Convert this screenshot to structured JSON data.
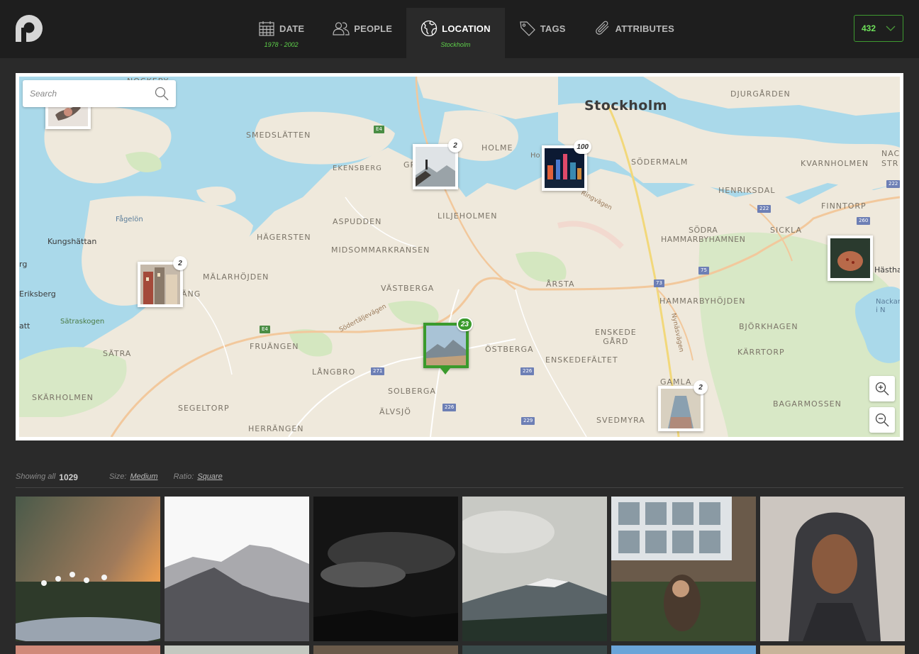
{
  "header": {
    "tabs": [
      {
        "label": "DATE",
        "sub": "1978 - 2002"
      },
      {
        "label": "PEOPLE",
        "sub": ""
      },
      {
        "label": "LOCATION",
        "sub": "Stockholm"
      },
      {
        "label": "TAGS",
        "sub": ""
      },
      {
        "label": "ATTRIBUTES",
        "sub": ""
      }
    ],
    "active_tab": "LOCATION",
    "count": "432"
  },
  "map": {
    "search_placeholder": "Search",
    "labels": {
      "stockholm": "Stockholm",
      "djurgarden": "DJURGÅRDEN",
      "nockeby": "NOCKEBY",
      "smedslatten": "SMEDSLÄTTEN",
      "ekensberg": "EKENSBERG",
      "holme": "HOLME",
      "sodermalm": "SÖDERMALM",
      "kvarnholmen": "KVARNHOLMEN",
      "nac": "NAC",
      "str": "STR",
      "henriksdal": "HENRIKSDAL",
      "finntorp": "FINNTORP",
      "fagelon": "Fågelön",
      "aspudden": "ASPUDDEN",
      "liljeholmen": "LILJEHOLMEN",
      "sodra_hammarbyhamnen": "SÖDRA\nHAMMARBYHAMNEN",
      "sickla": "SICKLA",
      "kungshattan": "Kungshättan",
      "hagersten": "HÄGERSTEN",
      "midsommarkransen": "MIDSOMMARKRANSEN",
      "rg": "rg",
      "malarhojden": "MÄLARHÖJDEN",
      "hasthag": "Hästha",
      "eriksberg": "Eriksberg",
      "ang": "ÄNG",
      "vastberga": "VÄSTBERGA",
      "arsta": "ÅRSTA",
      "hammarbyhojden": "HAMMARBYHÖJDEN",
      "nackar": "Nackar\ni N",
      "satraskogen": "Sätraskogen",
      "att": "att",
      "bjorkhagen": "BJÖRKHAGEN",
      "sodertaljevagen": "Södertäljevägen",
      "enskede_gard": "ENSKEDE\nGÅRD",
      "nynasvagen": "Nynäsvägen",
      "satra": "SÄTRA",
      "fruangen": "FRUÄNGEN",
      "ostberga": "ÖSTBERGA",
      "karrtorp": "KÄRRTORP",
      "langbro": "LÅNGBRO",
      "enskedefaltet": "ENSKEDEFÄLTET",
      "solberga": "SOLBERGA",
      "gamla": "GAMLA",
      "skarholmen": "SKÄRHOLMEN",
      "bagarmossen": "BAGARMOSSEN",
      "segeltorp": "SEGELTORP",
      "alvsjo": "ÄLVSJÖ",
      "svedmyra": "SVEDMYRA",
      "herrangen": "HERRÄNGEN",
      "ringvagen": "Ringvägen",
      "gr": "GR",
      "ho": "Ho"
    },
    "shields": [
      "E4",
      "E4",
      "271",
      "226",
      "226",
      "229",
      "73",
      "75",
      "222",
      "222",
      "260"
    ],
    "pins": [
      {
        "name": "pin-nockeby",
        "count": ""
      },
      {
        "name": "pin-hornstull",
        "count": "2"
      },
      {
        "name": "pin-gamla-stan",
        "count": "100"
      },
      {
        "name": "pin-malarhojden",
        "count": "2"
      },
      {
        "name": "pin-vastberga",
        "count": "23"
      },
      {
        "name": "pin-sickla",
        "count": ""
      },
      {
        "name": "pin-gamla-enskede",
        "count": "2"
      }
    ]
  },
  "results": {
    "showing_label": "Showing all",
    "showing_count": "1029",
    "size_label": "Size:",
    "size_value": "Medium",
    "ratio_label": "Ratio:",
    "ratio_value": "Square"
  }
}
